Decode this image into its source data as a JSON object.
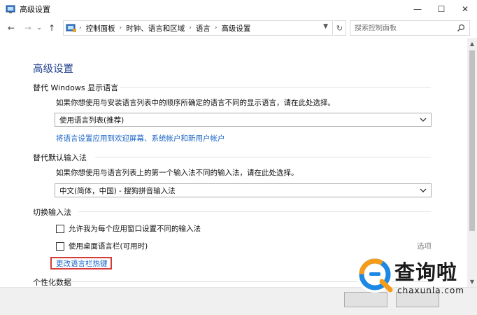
{
  "window": {
    "title": "高级设置",
    "minimize_glyph": "—",
    "maximize_glyph": "☐",
    "close_glyph": "✕"
  },
  "nav": {
    "back_glyph": "←",
    "forward_glyph": "→",
    "recent_glyph": "⌄",
    "up_glyph": "↑",
    "breadcrumbs": [
      "控制面板",
      "时钟、语言和区域",
      "语言",
      "高级设置"
    ],
    "crumb_sep": "›",
    "refresh_glyph": "↻",
    "search_placeholder": "搜索控制面板"
  },
  "page": {
    "title": "高级设置",
    "display_language": {
      "heading": "替代 Windows 显示语言",
      "description": "如果你想使用与安装语言列表中的顺序所确定的语言不同的显示语言，请在此处选择。",
      "selected": "使用语言列表(推荐)",
      "apply_link": "将语言设置应用到欢迎屏幕、系统帐户和新用户帐户"
    },
    "default_input": {
      "heading": "替代默认输入法",
      "description": "如果你想使用与语言列表上的第一个输入法不同的输入法，请在此处选择。",
      "selected": "中文(简体，中国) - 搜狗拼音输入法"
    },
    "switch_input": {
      "heading": "切换输入法",
      "checkbox_per_app": "允许我为每个应用窗口设置不同的输入法",
      "checkbox_langbar": "使用桌面语言栏(可用时)",
      "options_link": "选项",
      "hotkey_link": "更改语言栏热键"
    },
    "personalization": {
      "heading": "个性化数据"
    }
  },
  "watermark": {
    "cn_text": "查询啦",
    "en_text": "chaxunla.com"
  },
  "colors": {
    "title_blue": "#1e3f8a",
    "link_blue": "#1a64c7",
    "highlight_red": "#d63a3a"
  }
}
